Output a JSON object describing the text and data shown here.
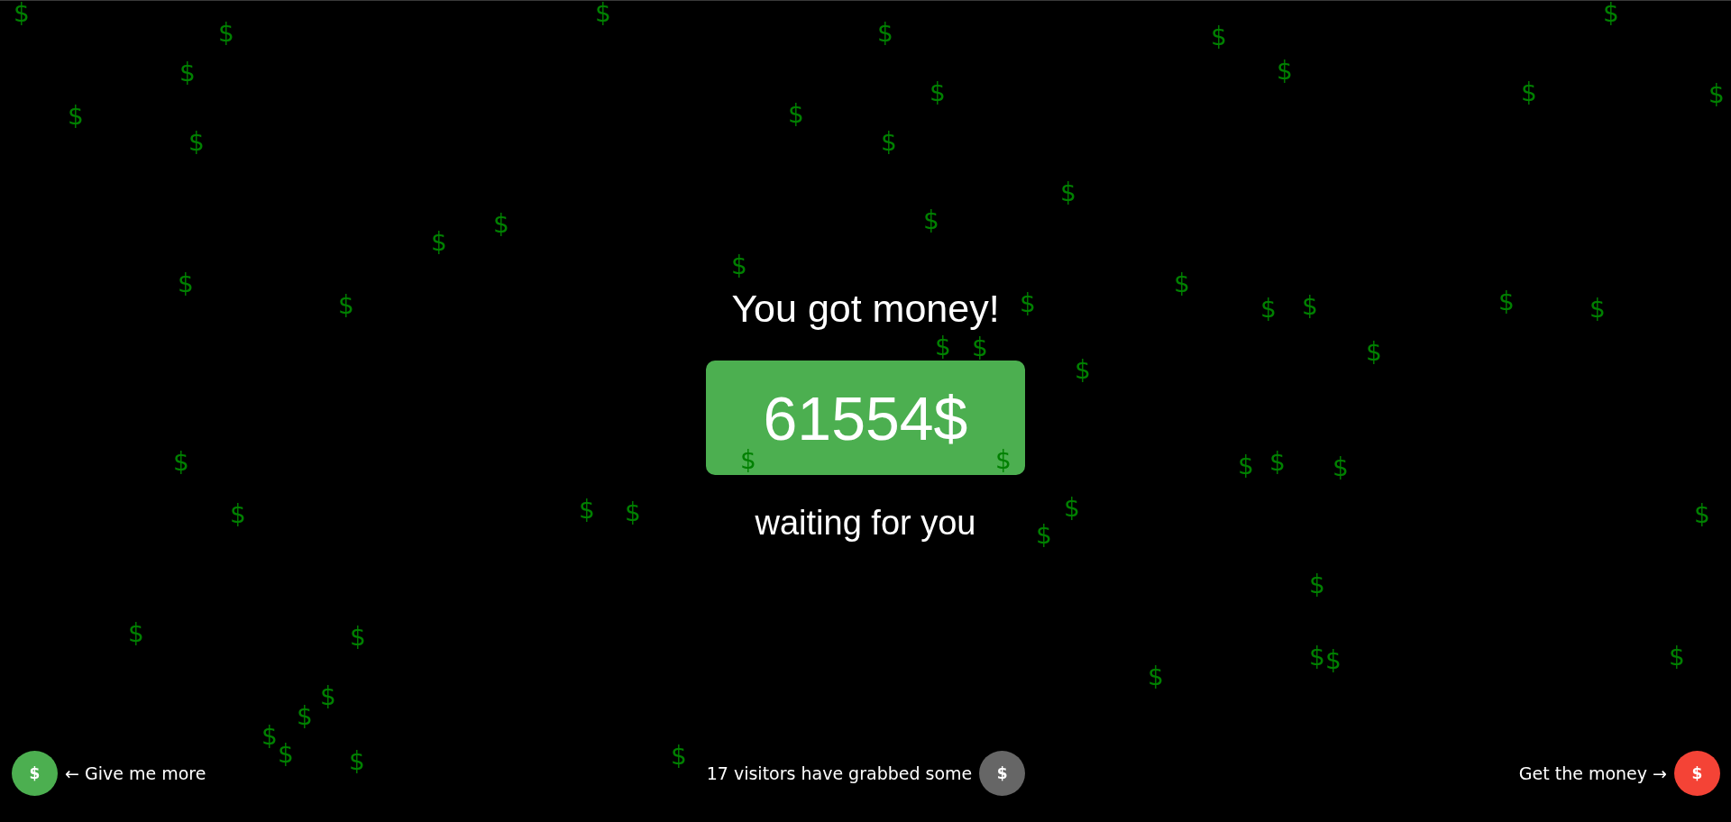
{
  "falling_symbols": [
    "$",
    "$",
    "$",
    "$",
    "$",
    "$",
    "$",
    "$",
    "$",
    "$",
    "$",
    "$",
    "$",
    "$",
    "$",
    "$",
    "$",
    "$",
    "$",
    "$",
    "$",
    "$",
    "$",
    "$",
    "$",
    "$",
    "$",
    "$",
    "$",
    "$",
    "$",
    "$",
    "$",
    "$",
    "$",
    "$",
    "$",
    "$",
    "$",
    "$",
    "$",
    "$",
    "$",
    "$",
    "$",
    "$",
    "$",
    "$",
    "$",
    "$",
    "$",
    "$",
    "$",
    "$",
    "$",
    "$",
    "$"
  ],
  "heading": "You got money!",
  "amount": "61554$",
  "subheading": "waiting for you",
  "footer": [
    {
      "kind": "leading",
      "label": "← Give me more",
      "symbol": "$",
      "color": "#4caf50"
    },
    {
      "kind": "trailing",
      "label": "17 visitors have grabbed some",
      "symbol": "$",
      "color": "#666666"
    },
    {
      "kind": "trailing",
      "label": "Get the money →",
      "symbol": "$",
      "color": "#f44336"
    }
  ]
}
